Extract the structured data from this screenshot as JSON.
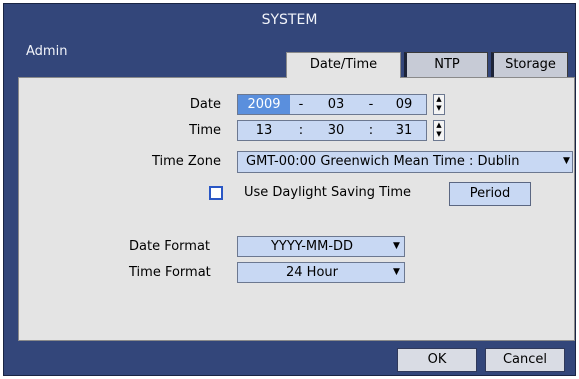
{
  "window": {
    "title": "SYSTEM",
    "user": "Admin"
  },
  "tabs": [
    {
      "label": "Date/Time",
      "active": true
    },
    {
      "label": "NTP",
      "active": false
    },
    {
      "label": "Storage",
      "active": false
    }
  ],
  "fields": {
    "date_label": "Date",
    "date": {
      "year": "2009",
      "sep1": "-",
      "month": "03",
      "sep2": "-",
      "day": "09"
    },
    "time_label": "Time",
    "time": {
      "hour": "13",
      "sep1": ":",
      "minute": "30",
      "sep2": ":",
      "second": "31"
    },
    "timezone_label": "Time Zone",
    "timezone_value": "GMT-00:00 Greenwich Mean Time : Dublin",
    "dst_label": "Use Daylight Saving Time",
    "dst_checked": false,
    "period_button": "Period",
    "date_format_label": "Date Format",
    "date_format_value": "YYYY-MM-DD",
    "time_format_label": "Time Format",
    "time_format_value": "24 Hour"
  },
  "buttons": {
    "ok": "OK",
    "cancel": "Cancel"
  },
  "colors": {
    "window_bg": "#33467a",
    "panel_bg": "#e4e4e4",
    "field_bg": "#c8d8f3",
    "selected_bg": "#5a8fdd",
    "checkbox_border": "#2a57c5"
  },
  "icons": {
    "spinner": "up-down-spinner-icon",
    "dropdown": "chevron-down-icon"
  }
}
